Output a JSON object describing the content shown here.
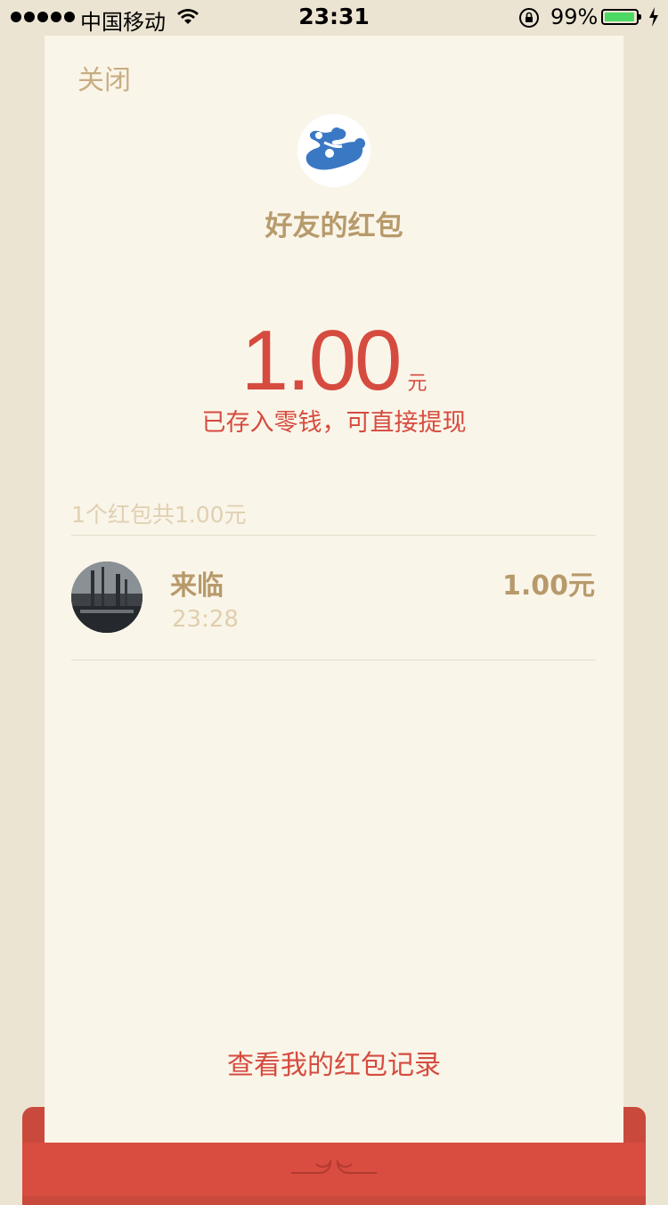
{
  "status_bar": {
    "carrier": "中国移动",
    "time": "23:31",
    "battery": "99%",
    "battery_level": 0.99
  },
  "header": {
    "close_label": "关闭"
  },
  "packet": {
    "title": "好友的红包",
    "amount": "1.00",
    "unit": "元",
    "note": "已存入零钱，可直接提现"
  },
  "list": {
    "summary": "1个红包共1.00元",
    "items": [
      {
        "name": "来临",
        "time": "23:28",
        "amount": "1.00元"
      }
    ]
  },
  "footer": {
    "history_label": "查看我的红包记录"
  },
  "colors": {
    "accent_red": "#d64b3f",
    "gold_text": "#b79a6b",
    "card_bg": "#faf5e9",
    "page_bg": "#ece4d2"
  }
}
